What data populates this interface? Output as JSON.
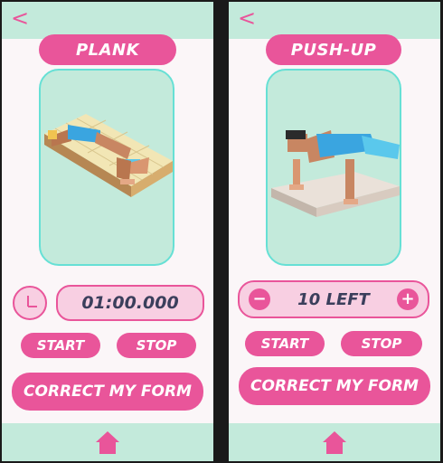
{
  "screens": [
    {
      "back_icon": "chevron-left-icon",
      "title": "PLANK",
      "image": "plank-illustration",
      "timer": "01:00.000",
      "start_label": "START",
      "stop_label": "STOP",
      "correct_label": "CORRECT MY FORM",
      "home_icon": "home-icon"
    },
    {
      "back_icon": "chevron-left-icon",
      "title": "PUSH-UP",
      "image": "pushup-illustration",
      "counter": "10 LEFT",
      "minus_label": "−",
      "plus_label": "+",
      "start_label": "START",
      "stop_label": "STOP",
      "correct_label": "CORRECT MY FORM",
      "home_icon": "home-icon"
    }
  ],
  "colors": {
    "accent": "#e9559a",
    "mint": "#c3eadb",
    "soft_pink": "#f8cfe2",
    "text_dark": "#3b3f5c"
  }
}
